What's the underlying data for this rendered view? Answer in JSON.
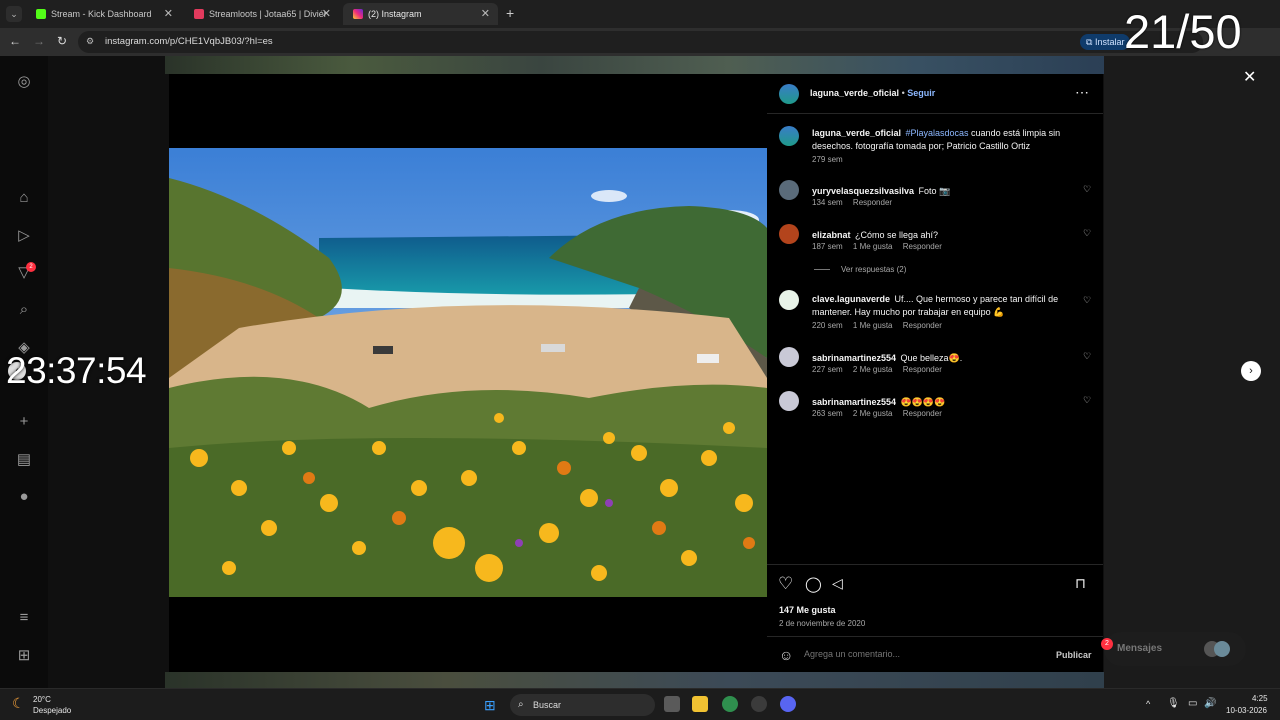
{
  "browser": {
    "tabs": [
      {
        "label": "Stream - Kick Dashboard",
        "color": "#53fc18"
      },
      {
        "label": "Streamloots | Jotaa65 | Diviérte",
        "color": "#e23a5d"
      },
      {
        "label": "(2) Instagram",
        "color": "#d6249f"
      }
    ],
    "url": "instagram.com/p/CHE1VqbJB03/?hl=es",
    "install_label": "Instalar"
  },
  "overlay": {
    "counter": "21/50",
    "clock": "23:37:54"
  },
  "post": {
    "username": "laguna_verde_oficial",
    "follow_label": "Seguir",
    "caption": {
      "username": "laguna_verde_oficial",
      "hashtag": "#Playalasdocas",
      "text": " cuando está limpia sin desechos. fotografía tomada por; Patricio Castillo Ortiz",
      "time": "279 sem"
    },
    "comments": [
      {
        "username": "yuryvelasquezsilvasilva",
        "text": "Foto 📷",
        "time": "134 sem",
        "likes": "",
        "reply": "Responder"
      },
      {
        "username": "elizabnat",
        "text": "¿Cómo se llega ahí?",
        "time": "187 sem",
        "likes": "1 Me gusta",
        "reply": "Responder"
      },
      {
        "username": "clave.lagunaverde",
        "text": "Uf.... Que hermoso y parece tan difícil de mantener. Hay mucho por trabajar en equipo 💪",
        "time": "220 sem",
        "likes": "1 Me gusta",
        "reply": "Responder"
      },
      {
        "username": "sabrinamartinez554",
        "text": "Que belleza😍.",
        "time": "227 sem",
        "likes": "2 Me gusta",
        "reply": "Responder"
      },
      {
        "username": "sabrinamartinez554",
        "text": "😍😍😍😍",
        "time": "263 sem",
        "likes": "2 Me gusta",
        "reply": "Responder"
      }
    ],
    "view_replies": "Ver respuestas (2)",
    "likes_count": "147 Me gusta",
    "date": "2 de noviembre de 2020",
    "comment_placeholder": "Agrega un comentario...",
    "publish_label": "Publicar"
  },
  "messages_label": "Mensajes",
  "taskbar": {
    "temperature": "20°C",
    "weather": "Despejado",
    "search_label": "Buscar",
    "time": "4:25",
    "date": "10-03-2026"
  },
  "colors": {
    "accent_link": "#8db8ff",
    "badge_red": "#ff3040"
  }
}
